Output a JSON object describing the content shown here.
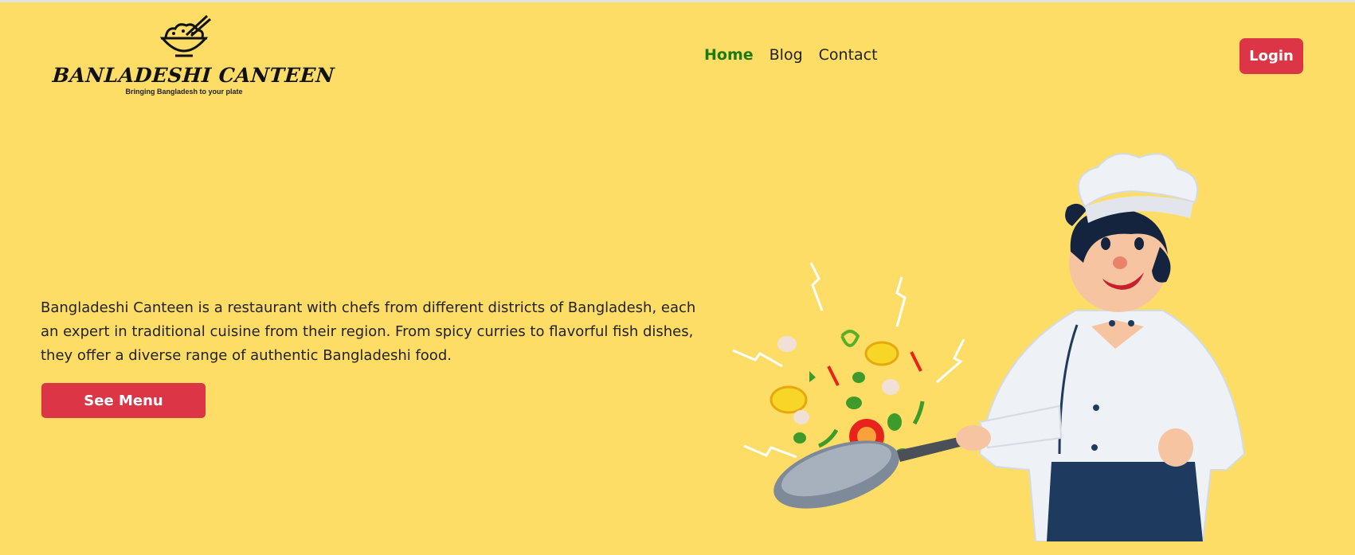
{
  "header": {
    "logo": {
      "title": "BANLADESHI CANTEEN",
      "tagline": "Bringing Bangladesh to your plate",
      "icon": "rice-bowl-chopsticks-icon"
    },
    "nav": [
      {
        "label": "Home",
        "active": true
      },
      {
        "label": "Blog",
        "active": false
      },
      {
        "label": "Contact",
        "active": false
      }
    ],
    "login_label": "Login"
  },
  "hero": {
    "description": "Bangladeshi Canteen is a restaurant with chefs from different districts of Bangladesh, each an expert in traditional cuisine from their region. From spicy curries to flavorful fish dishes, they offer a diverse range of authentic Bangladeshi food.",
    "cta_label": "See Menu",
    "illustration": "chef-tossing-vegetables-in-pan"
  },
  "colors": {
    "background": "#FDDD66",
    "accent": "#DC3545",
    "nav_active": "#1c7a10"
  }
}
